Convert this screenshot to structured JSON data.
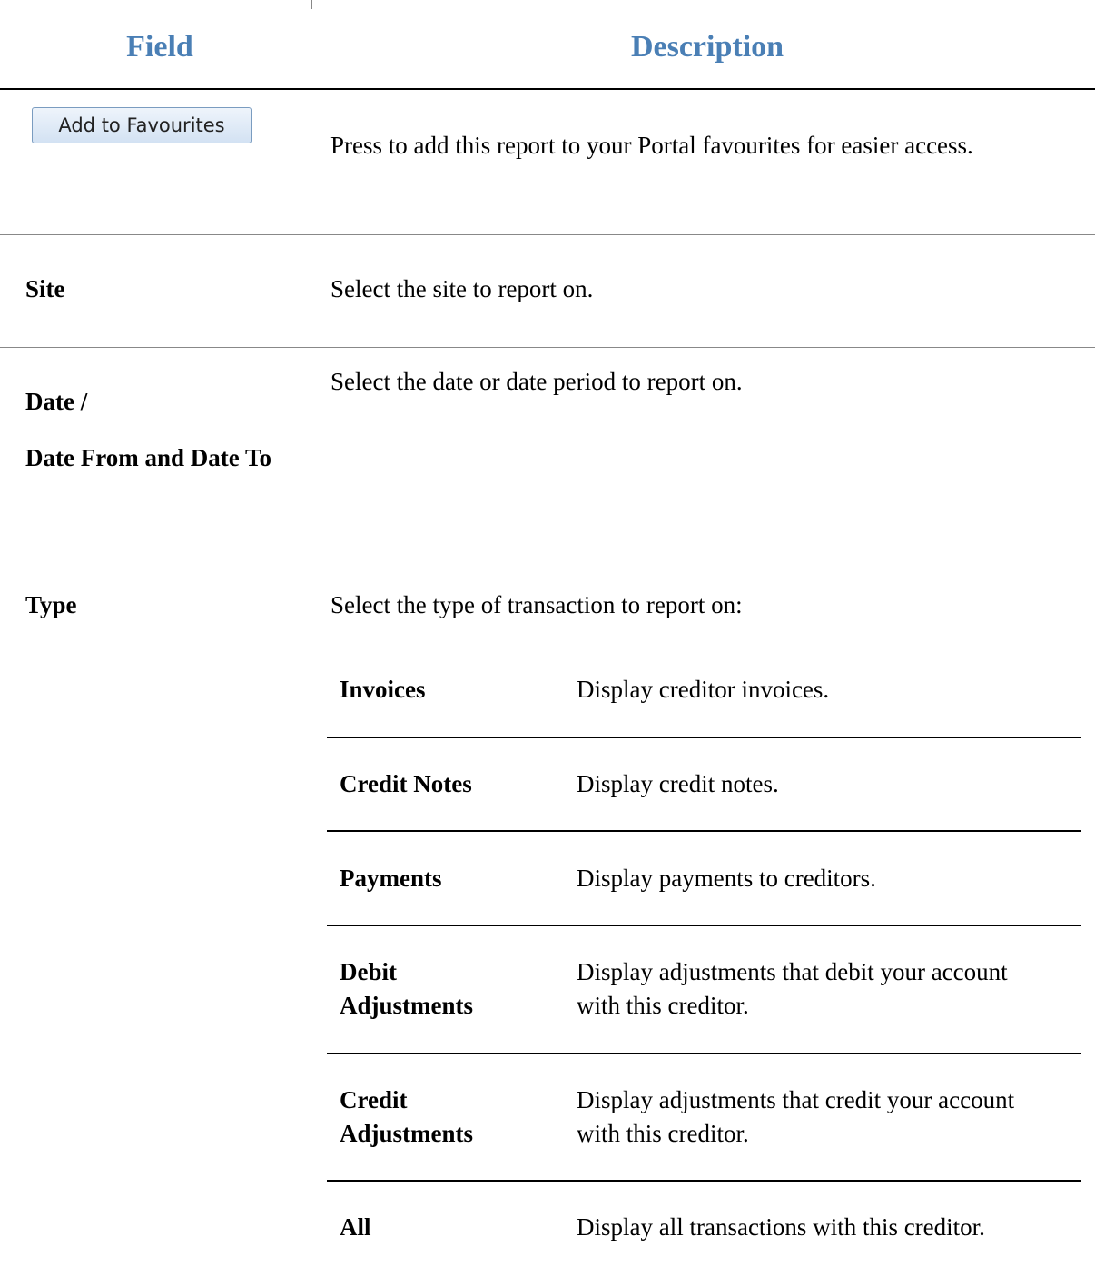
{
  "header": {
    "field": "Field",
    "description": "Description"
  },
  "rows": {
    "favourites": {
      "button_label": "Add to Favourites",
      "description": "Press to add this report to your Portal favourites for easier access."
    },
    "site": {
      "label": "Site",
      "description": "Select the site to report on."
    },
    "date": {
      "label_line1": "Date /",
      "label_line2": "Date From and Date To",
      "description": "Select the date or date period to report on."
    },
    "type": {
      "label": "Type",
      "description": "Select the type of transaction to report on:"
    }
  },
  "type_options": [
    {
      "label": "Invoices",
      "description": "Display creditor invoices."
    },
    {
      "label": "Credit Notes",
      "description": "Display credit notes."
    },
    {
      "label": "Payments",
      "description": "Display payments to creditors."
    },
    {
      "label": "Debit Adjustments",
      "description": "Display adjustments that debit your account with this creditor."
    },
    {
      "label": "Credit Adjustments",
      "description": "Display adjustments that credit your account with this creditor."
    },
    {
      "label": "All",
      "description": "Display all transactions with this creditor."
    }
  ],
  "colors": {
    "header_text": "#4a7fb5",
    "button_border": "#7a9cc0"
  }
}
